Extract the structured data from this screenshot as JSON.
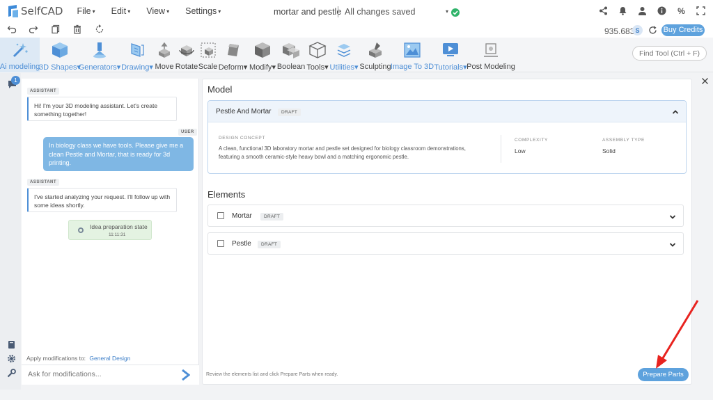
{
  "app": {
    "name": "SelfCAD",
    "menu": [
      "File",
      "Edit",
      "View",
      "Settings"
    ],
    "document_title": "mortar and pestle",
    "save_status": "All changes saved"
  },
  "account": {
    "credits": "935.683",
    "buy_label": "Buy Credits"
  },
  "ribbon": {
    "tools": [
      {
        "label": "Ai modeling",
        "style": "blue",
        "icon": "ai-wand-icon"
      },
      {
        "label": "3D Shapes",
        "style": "blue",
        "caret": true,
        "icon": "cube-icon"
      },
      {
        "label": "Generators",
        "style": "blue",
        "caret": true,
        "icon": "generator-icon"
      },
      {
        "label": "Drawing",
        "style": "blue",
        "caret": true,
        "icon": "drawing-icon"
      },
      {
        "label": "Move",
        "icon": "move-icon"
      },
      {
        "label": "Rotate",
        "icon": "rotate-icon"
      },
      {
        "label": "Scale",
        "icon": "scale-icon"
      },
      {
        "label": "Deform",
        "caret": true,
        "icon": "deform-icon"
      },
      {
        "label": "Modify",
        "caret": true,
        "icon": "modify-icon"
      },
      {
        "label": "Boolean",
        "icon": "boolean-icon"
      },
      {
        "label": "Tools",
        "caret": true,
        "icon": "tools-icon"
      },
      {
        "label": "Utilities",
        "style": "blue",
        "caret": true,
        "icon": "utilities-icon"
      },
      {
        "label": "Sculpting",
        "icon": "sculpting-icon"
      },
      {
        "label": "Image To 3D",
        "style": "blue",
        "icon": "image-to-3d-icon"
      },
      {
        "label": "Tutorials",
        "style": "blue",
        "caret": true,
        "icon": "tutorials-icon"
      },
      {
        "label": "Post Modeling",
        "icon": "post-modeling-icon"
      }
    ],
    "find_tool_placeholder": "Find Tool (Ctrl + F)"
  },
  "chat": {
    "badge_count": "1",
    "messages": [
      {
        "role": "ASSISTANT",
        "text": "Hi! I'm your 3D modeling assistant. Let's create something together!"
      },
      {
        "role": "USER",
        "text": "In biology class we have tools. Please give me a clean Pestle and Mortar, that is ready for 3d printing."
      },
      {
        "role": "ASSISTANT",
        "text": "I've started analyzing your request. I'll follow up with some ideas shortly."
      }
    ],
    "state": {
      "title": "Idea preparation state",
      "time": "11:11:31"
    },
    "apply_label": "Apply modifications to:",
    "apply_target": "General Design",
    "input_placeholder": "Ask for modifications..."
  },
  "model": {
    "section_title": "Model",
    "name": "Pestle And Mortar",
    "status": "DRAFT",
    "concept_label": "DESIGN CONCEPT",
    "concept_text": "A clean, functional 3D laboratory mortar and pestle set designed for biology classroom demonstrations, featuring a smooth ceramic-style heavy bowl and a matching ergonomic pestle.",
    "complexity_label": "COMPLEXITY",
    "complexity_value": "Low",
    "assembly_label": "ASSEMBLY TYPE",
    "assembly_value": "Solid"
  },
  "elements": {
    "section_title": "Elements",
    "items": [
      {
        "name": "Mortar",
        "status": "DRAFT"
      },
      {
        "name": "Pestle",
        "status": "DRAFT"
      }
    ]
  },
  "footer": {
    "hint": "Review the elements list and click Prepare Parts when ready.",
    "prepare_label": "Prepare Parts"
  },
  "colors": {
    "accent": "#5ea2dd",
    "link": "#3d7fc8",
    "user_bubble": "#7fb7e4",
    "annotation_arrow": "#e8231f"
  }
}
